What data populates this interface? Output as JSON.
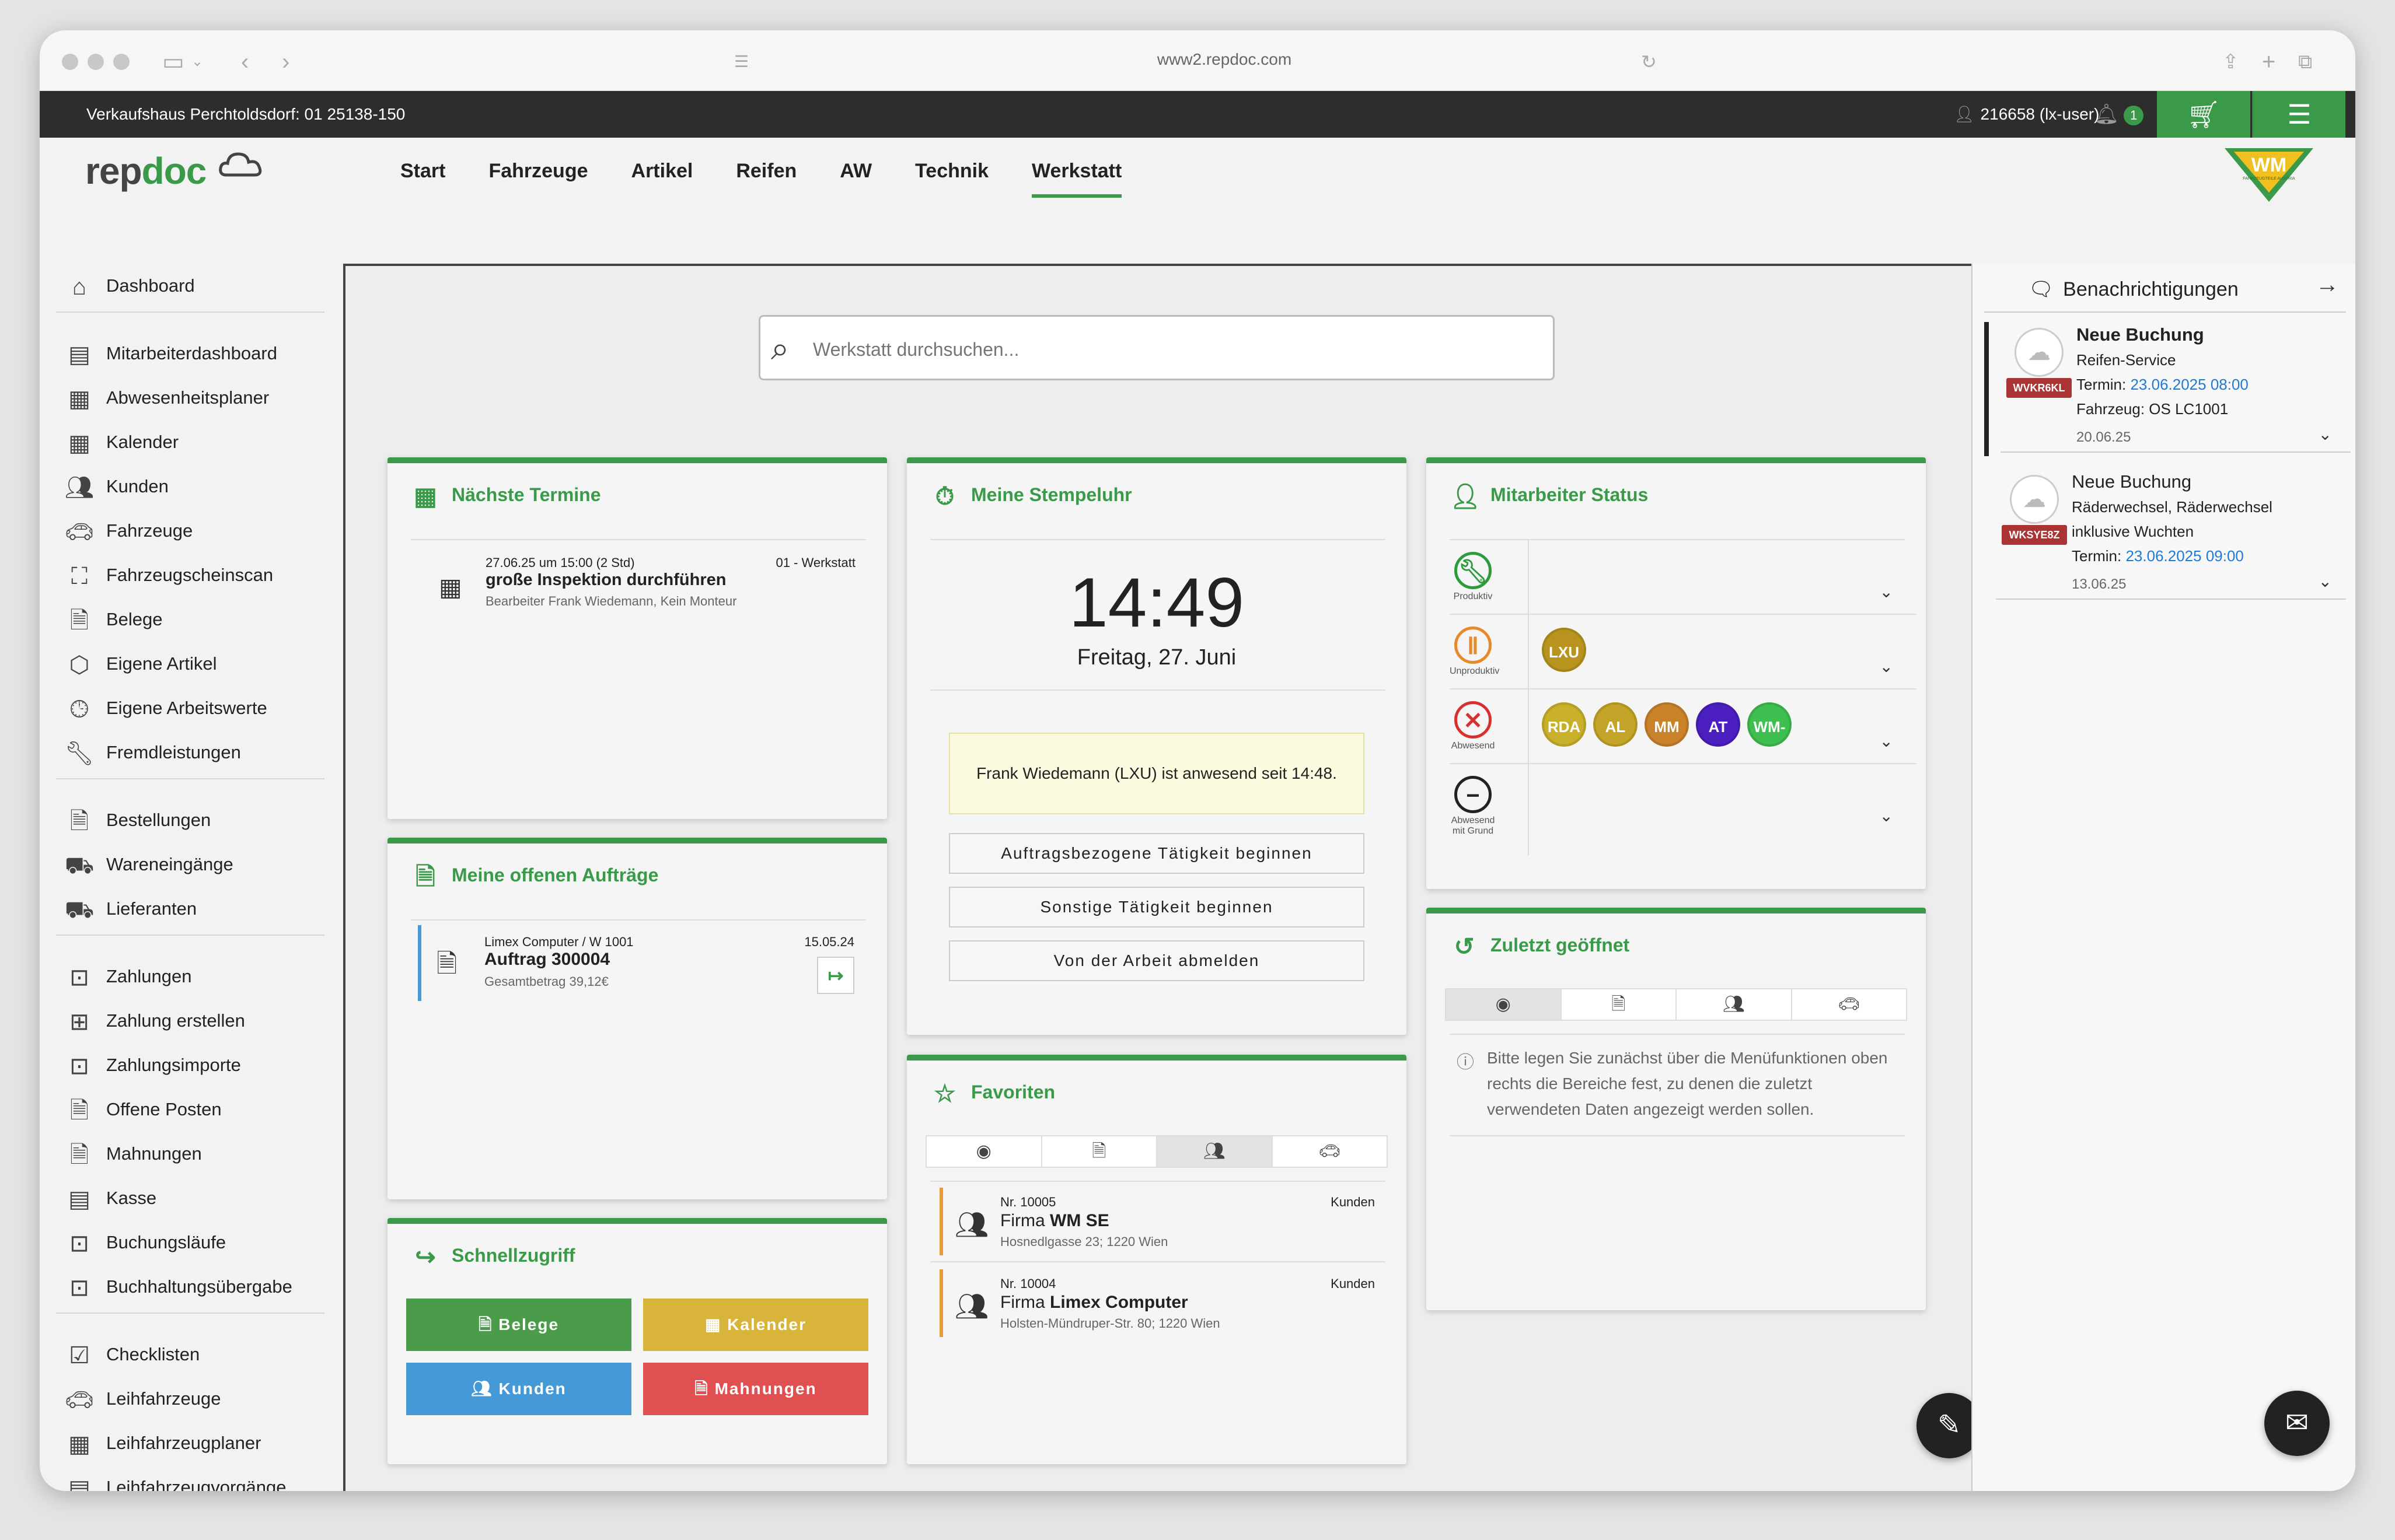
{
  "browser": {
    "url": "www2.repdoc.com"
  },
  "topbar": {
    "shop": "Verkaufshaus Perchtoldsdorf: 01 25138-150",
    "user": "216658 (lx-user)",
    "notification_count": "1"
  },
  "logo": {
    "rep": "rep",
    "doc": "doc",
    "partner_short": "WM",
    "partner_sub": "FAHRZEUGTEILE AUSTRIA"
  },
  "nav": [
    "Start",
    "Fahrzeuge",
    "Artikel",
    "Reifen",
    "AW",
    "Technik",
    "Werkstatt"
  ],
  "sidebar": {
    "items": [
      "Dashboard",
      "Mitarbeiterdashboard",
      "Abwesenheitsplaner",
      "Kalender",
      "Kunden",
      "Fahrzeuge",
      "Fahrzeugscheinscan",
      "Belege",
      "Eigene Artikel",
      "Eigene Arbeitswerte",
      "Fremdleistungen",
      "Bestellungen",
      "Wareneingänge",
      "Lieferanten",
      "Zahlungen",
      "Zahlung erstellen",
      "Zahlungsimporte",
      "Offene Posten",
      "Mahnungen",
      "Kasse",
      "Buchungsläufe",
      "Buchhaltungsübergabe",
      "Checklisten",
      "Leihfahrzeuge",
      "Leihfahrzeugplaner",
      "Leihfahrzeugvorgänge"
    ]
  },
  "search": {
    "placeholder": "Werkstatt durchsuchen..."
  },
  "termine": {
    "title": "Nächste Termine",
    "item": {
      "datetime": "27.06.25 um 15:00 (2 Std)",
      "location": "01 - Werkstatt",
      "title": "große Inspektion durchführen",
      "sub": "Bearbeiter Frank Wiedemann, Kein Monteur"
    }
  },
  "auftraege": {
    "title": "Meine offenen Aufträge",
    "item": {
      "customer": "Limex Computer / W 1001",
      "date": "15.05.24",
      "title": "Auftrag 300004",
      "sub": "Gesamtbetrag 39,12€"
    }
  },
  "schnellzugriff": {
    "title": "Schnellzugriff",
    "buttons": [
      "Belege",
      "Kalender",
      "Kunden",
      "Mahnungen"
    ],
    "colors": [
      "#4a9b4a",
      "#d8b43a",
      "#4499d6",
      "#e05050"
    ]
  },
  "stempeluhr": {
    "title": "Meine Stempeluhr",
    "time": "14:49",
    "date": "Freitag, 27. Juni",
    "status": "Frank Wiedemann (LXU) ist anwesend seit 14:48.",
    "buttons": [
      "Auftragsbezogene Tätigkeit beginnen",
      "Sonstige Tätigkeit beginnen",
      "Von der Arbeit abmelden"
    ]
  },
  "favoriten": {
    "title": "Favoriten",
    "items": [
      {
        "nr": "Nr. 10005",
        "cat": "Kunden",
        "prefix": "Firma ",
        "name": "WM SE",
        "addr": "Hosnedlgasse 23; 1220 Wien"
      },
      {
        "nr": "Nr. 10004",
        "cat": "Kunden",
        "prefix": "Firma ",
        "name": "Limex Computer",
        "addr": "Holsten-Mündruper-Str. 80; 1220 Wien"
      }
    ]
  },
  "mitarbeiter": {
    "title": "Mitarbeiter Status",
    "rows": [
      {
        "label": "Produktiv",
        "avatars": []
      },
      {
        "label": "Unproduktiv",
        "avatars": [
          "LXU"
        ]
      },
      {
        "label": "Abwesend",
        "avatars": [
          "RDA",
          "AL",
          "MM",
          "AT",
          "WM-"
        ]
      },
      {
        "label": "Abwesend mit Grund",
        "avatars": []
      }
    ],
    "avatar_colors": {
      "LXU": "#b8941e",
      "RDA": "#c9b02a",
      "AL": "#c4a428",
      "MM": "#c9822a",
      "AT": "#4b1fbf",
      "WM-": "#3fbf4f"
    },
    "status_colors": {
      "produktiv": "#2e9a3e",
      "unproduktiv": "#e88a2a",
      "abwesend": "#d83030",
      "grund": "#222222"
    }
  },
  "zuletzt": {
    "title": "Zuletzt geöffnet",
    "info": "Bitte legen Sie zunächst über die Menüfunktionen oben rechts die Bereiche fest, zu denen die zuletzt verwendeten Daten angezeigt werden sollen."
  },
  "notifications": {
    "title": "Benachrichtigungen",
    "items": [
      {
        "title": "Neue Buchung",
        "line1": "Reifen-Service",
        "termin_label": "Termin: ",
        "termin": "23.06.2025 08:00",
        "line3": "Fahrzeug: OS LC1001",
        "date": "20.06.25",
        "badge": "WVKR6KL"
      },
      {
        "title": "Neue Buchung",
        "line1": "Räderwechsel, Räderwechsel",
        "line2": "inklusive Wuchten",
        "termin_label": "Termin: ",
        "termin": "23.06.2025 09:00",
        "date": "13.06.25",
        "badge": "WKSYE8Z"
      }
    ]
  }
}
